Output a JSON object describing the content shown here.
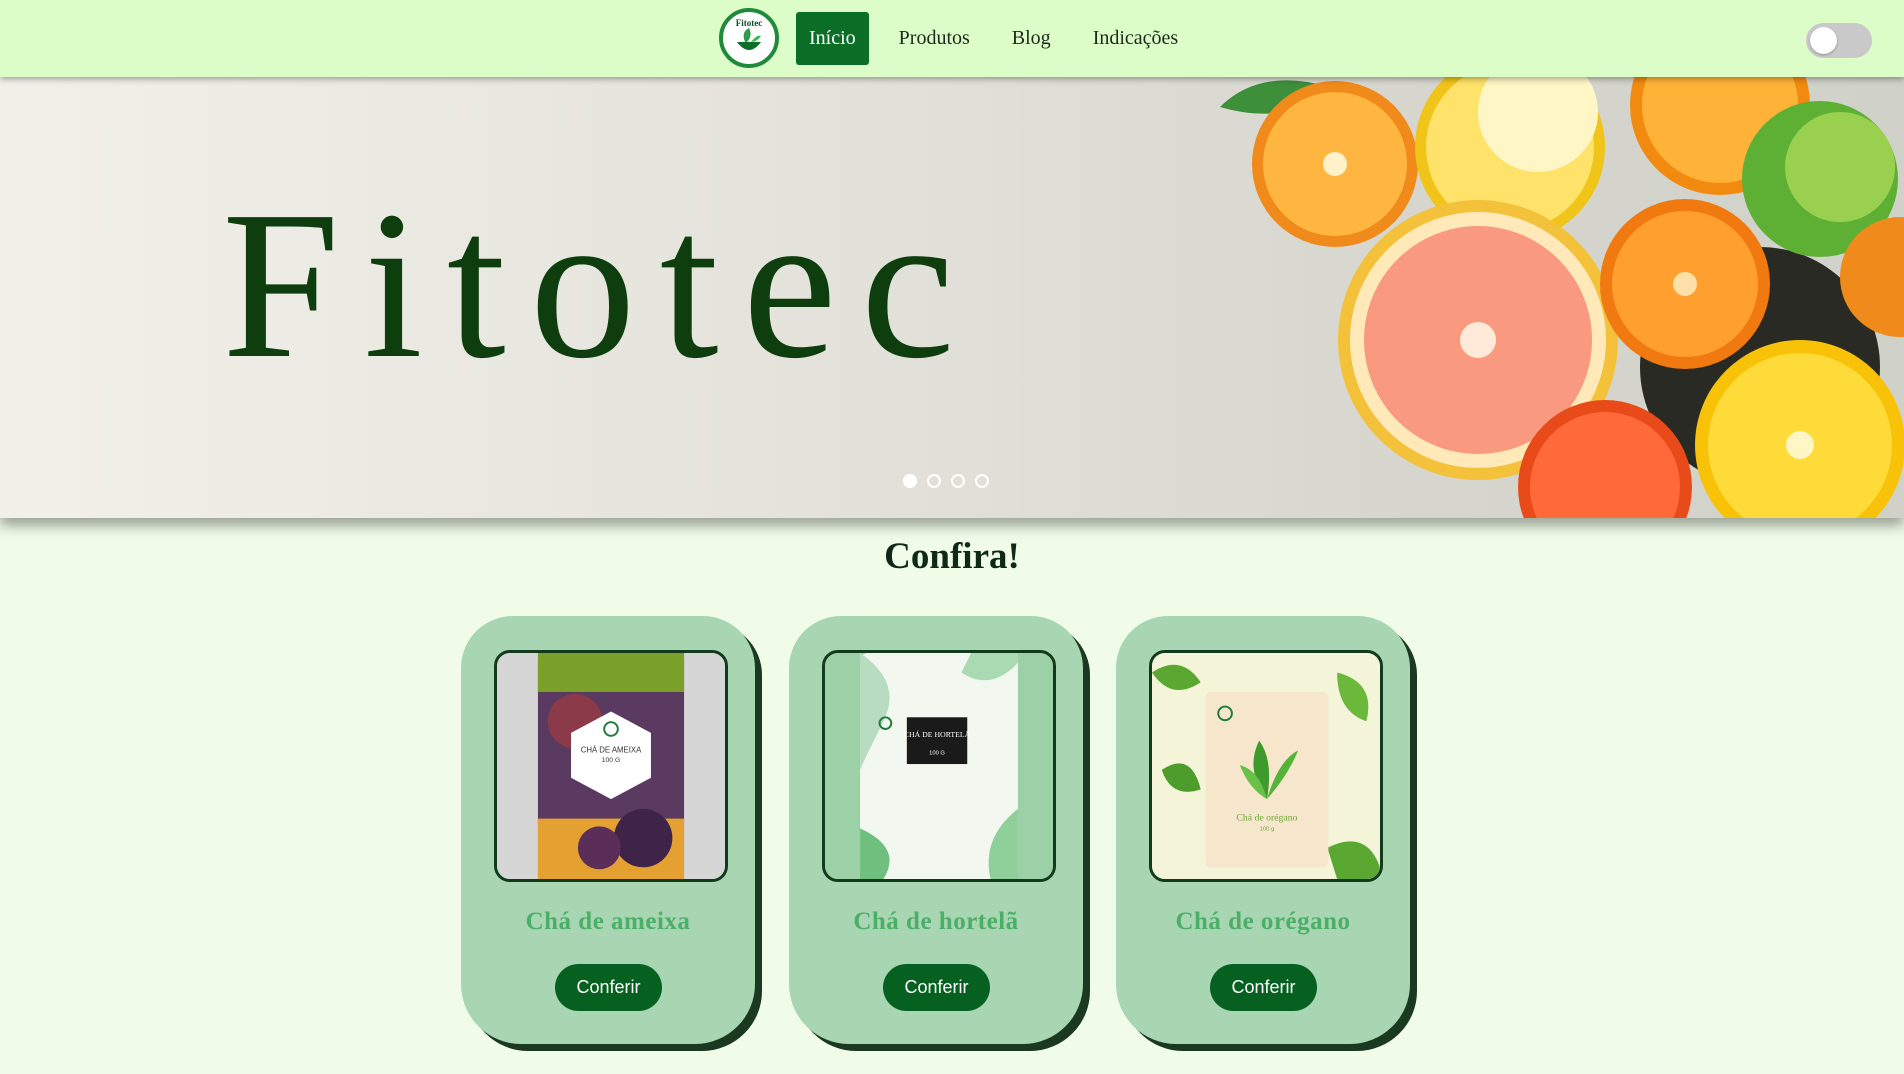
{
  "nav": {
    "logo_text": "Fitotec",
    "links": [
      {
        "label": "Início",
        "active": true
      },
      {
        "label": "Produtos",
        "active": false
      },
      {
        "label": "Blog",
        "active": false
      },
      {
        "label": "Indicações",
        "active": false
      }
    ],
    "theme_toggle": {
      "on": false
    }
  },
  "hero": {
    "title": "Fitotec",
    "slides_total": 4,
    "active_slide": 1
  },
  "section": {
    "title": "Confira!"
  },
  "products": [
    {
      "name": "Chá de ameixa",
      "button": "Conferir",
      "package_label": "CHÁ DE AMEIXA",
      "package_weight": "100 G"
    },
    {
      "name": "Chá de hortelã",
      "button": "Conferir",
      "package_label": "CHÁ DE HORTELÃ",
      "package_weight": "100 G"
    },
    {
      "name": "Chá de orégano",
      "button": "Conferir",
      "package_label": "Chá de orégano",
      "package_weight": "100 g"
    }
  ],
  "colors": {
    "nav_bg": "#dcfcc8",
    "page_bg": "#f0fce8",
    "accent_dark_green": "#0b6e26",
    "card_bg": "#a8d5b2",
    "card_title": "#4caf68",
    "hero_title": "#0e3d0e"
  }
}
